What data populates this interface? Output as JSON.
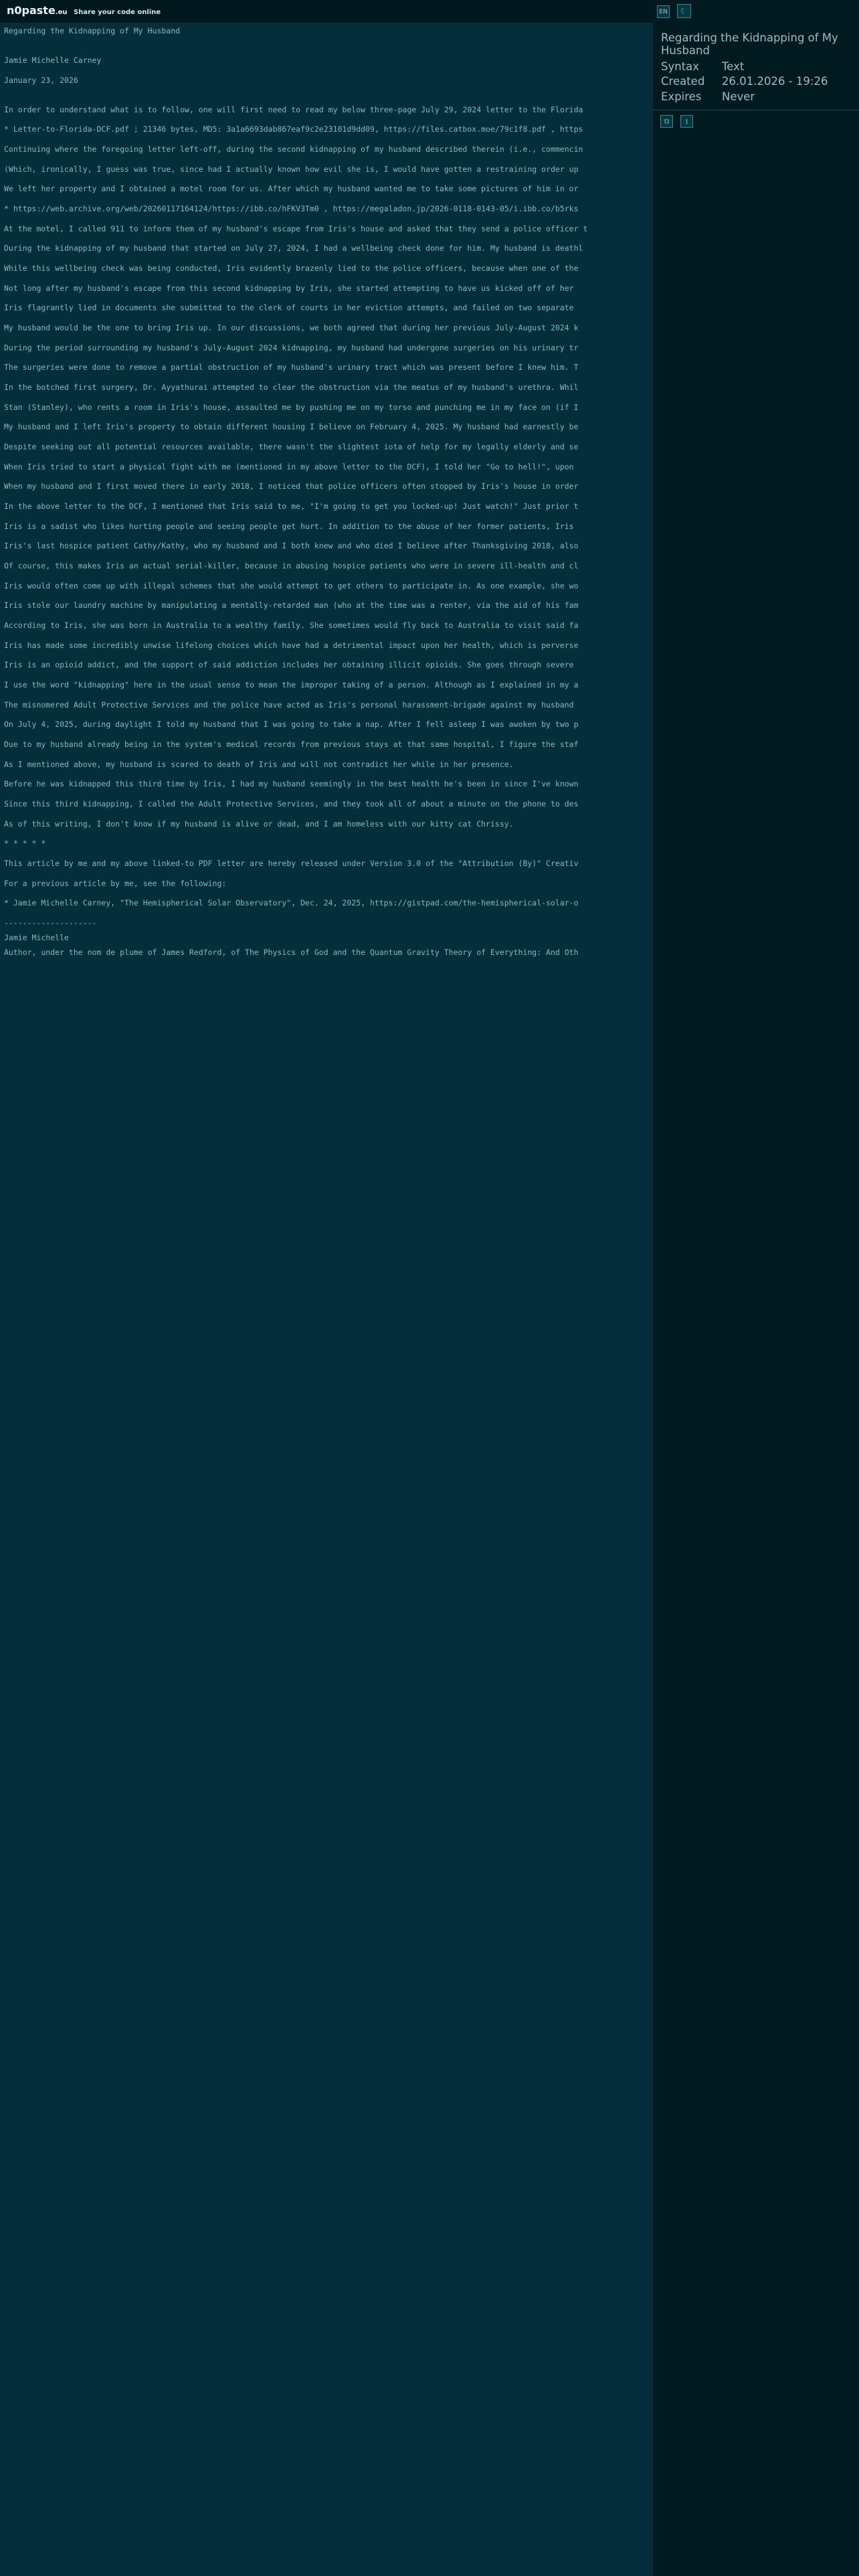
{
  "header": {
    "logo_main": "n0paste",
    "logo_tld": ".eu",
    "tagline": "Share your code online"
  },
  "paste": {
    "lines": [
      "Regarding the Kidnapping of My Husband",
      "Jamie Michelle Carney",
      "January 23, 2026",
      "In order to understand what is to follow, one will first need to read my below three-page July 29, 2024 letter to the Florida",
      "* Letter-to-Florida-DCF.pdf ; 21346 bytes, MD5: 3a1a6693dab867eaf9c2e23101d9dd09, https://files.catbox.moe/79c1f8.pdf , https",
      "Continuing where the foregoing letter left-off, during the second kidnapping of my husband described therein (i.e., commencin",
      "(Which, ironically, I guess was true, since had I actually known how evil she is, I would have gotten a restraining order up",
      "We left her property and I obtained a motel room for us. After which my husband wanted me to take some pictures of him in or",
      "* https://web.archive.org/web/20260117164124/https://ibb.co/hFKV3Tm0 , https://megaladon.jp/2026-0118-0143-05/i.ibb.co/b5rks",
      "At the motel, I called 911 to inform them of my husband's escape from Iris's house and asked that they send a police officer t",
      "During the kidnapping of my husband that started on July 27, 2024, I had a wellbeing check done for him. My husband is deathl",
      "While this wellbeing check was being conducted, Iris evidently brazenly lied to the police officers, because when one of the",
      "Not long after my husband's escape from this second kidnapping by Iris, she started attempting to have us kicked off of her",
      "Iris flagrantly lied in documents she submitted to the clerk of courts in her eviction attempts, and failed on two separate",
      "My husband would be the one to bring Iris up. In our discussions, we both agreed that during her previous July-August 2024 k",
      "During the period surrounding my husband's July-August 2024 kidnapping, my husband had undergone surgeries on his urinary tr",
      "The surgeries were done to remove a partial obstruction of my husband's urinary tract which was present before I knew him. T",
      "In the botched first surgery, Dr. Ayyathurai attempted to clear the obstruction via the meatus of my husband's urethra. Whil",
      "Stan (Stanley), who rents a room in Iris's house, assaulted me by pushing me on my torso and punching me in my face on (if I",
      "My husband and I left Iris's property to obtain different housing I believe on February 4, 2025. My husband had earnestly be",
      "Despite seeking out all potential resources available, there wasn't the slightest iota of help for my legally elderly and se",
      "When Iris tried to start a physical fight with me (mentioned in my above letter to the DCF), I told her \"Go to hell!\", upon",
      "When my husband and I first moved there in early 2018, I noticed that police officers often stopped by Iris's house in order",
      "In the above letter to the DCF, I mentioned that Iris said to me, \"I'm going to get you locked-up! Just watch!\" Just prior t",
      "Iris is a sadist who likes hurting people and seeing people get hurt. In addition to the abuse of her former patients, Iris",
      "Iris's last hospice patient Cathy/Kathy, who my husband and I both knew and who died I believe after Thanksgiving 2018, also",
      "Of course, this makes Iris an actual serial-killer, because in abusing hospice patients who were in severe ill-health and cl",
      "Iris would often come up with illegal schemes that she would attempt to get others to participate in. As one example, she wo",
      "Iris stole our laundry machine by manipulating a mentally-retarded man (who at the time was a renter, via the aid of his fam",
      "According to Iris, she was born in Australia to a wealthy family. She sometimes would fly back to Australia to visit said fa",
      "Iris has made some incredibly unwise lifelong choices which have had a detrimental impact upon her health, which is perverse",
      "Iris is an opioid addict, and the support of said addiction includes her obtaining illicit opioids. She goes through severe",
      "I use the word \"kidnapping\" here in the usual sense to mean the improper taking of a person. Although as I explained in my a",
      "The misnomered Adult Protective Services and the police have acted as Iris's personal harassment-brigade against my husband",
      "On July 4, 2025, during daylight I told my husband that I was going to take a nap. After I fell asleep I was awoken by two p",
      "Due to my husband already being in the system's medical records from previous stays at that same hospital, I figure the staf",
      "As I mentioned above, my husband is scared to death of Iris and will not contradict her while in her presence.",
      "Before he was kidnapped this third time by Iris, I had my husband seemingly in the best health he's been in since I've known",
      "Since this third kidnapping, I called the Adult Protective Services, and they took all of about a minute on the phone to des",
      "As of this writing, I don't know if my husband is alive or dead, and I am homeless with our kitty cat Chrissy.",
      "* * * * *",
      "This article by me and my above linked-to PDF letter are hereby released under Version 3.0 of the \"Attribution (By)\" Creativ",
      "For a previous article by me, see the following:",
      "* Jamie Michelle Carney, \"The Hemispherical Solar Observatory\", Dec. 24, 2025, https://gistpad.com/the-hemispherical-solar-o",
      "--------------------",
      "Jamie Michelle",
      "Author, under the nom de plume of James Redford, of The Physics of God and the Quantum Gravity Theory of Everything: And Oth"
    ]
  },
  "sidebar": {
    "lang_label": "EN",
    "theme_icon": "moon-icon",
    "title": "Regarding the Kidnapping of My Husband",
    "meta": [
      {
        "key": "Syntax",
        "value": "Text"
      },
      {
        "key": "Created",
        "value": "26.01.2026 - 19:26"
      },
      {
        "key": "Expires",
        "value": "Never"
      }
    ],
    "actions": [
      {
        "icon": "copy-icon",
        "glyph": "⧉"
      },
      {
        "icon": "download-icon",
        "glyph": "⭳"
      }
    ]
  },
  "colors": {
    "page_bg": "#022f3a",
    "topbar_bg": "#01181e",
    "sidebar_bg": "#011a20",
    "text": "#8fb6bf",
    "sidebar_text": "#9dbcc3"
  }
}
